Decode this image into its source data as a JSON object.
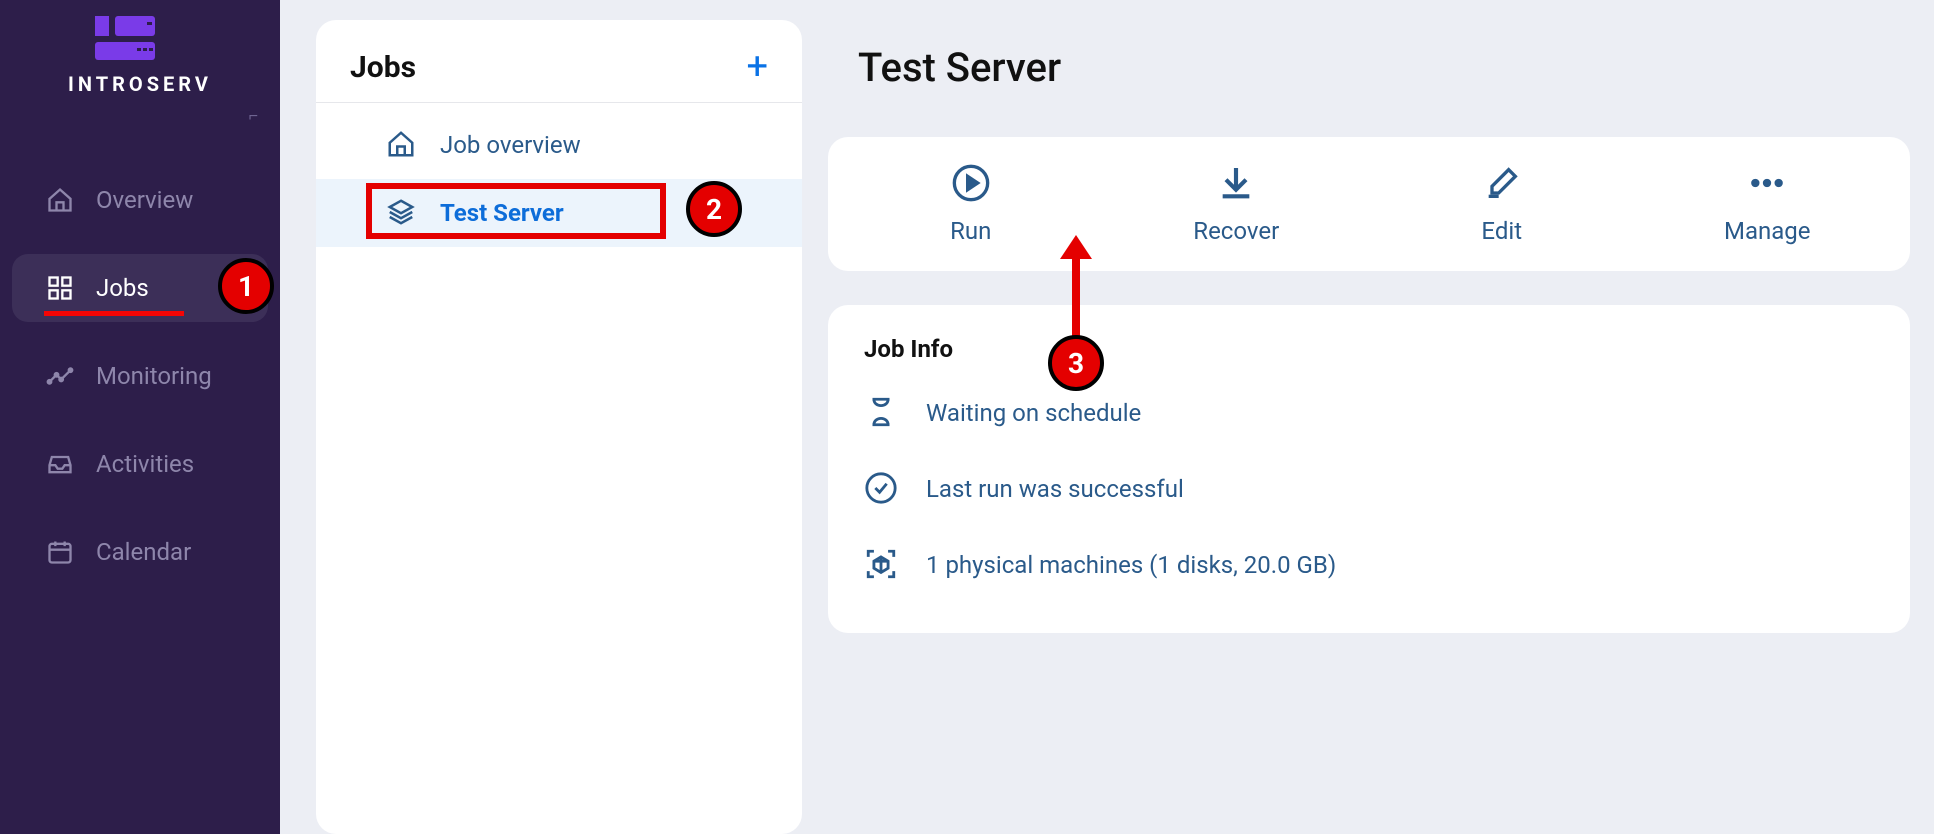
{
  "brand": {
    "name": "INTROSERV"
  },
  "sidebar": {
    "items": [
      {
        "label": "Overview",
        "icon": "home"
      },
      {
        "label": "Jobs",
        "icon": "grid"
      },
      {
        "label": "Monitoring",
        "icon": "chart"
      },
      {
        "label": "Activities",
        "icon": "inbox"
      },
      {
        "label": "Calendar",
        "icon": "calendar"
      }
    ],
    "active_index": 1
  },
  "jobs_panel": {
    "title": "Jobs",
    "items": [
      {
        "label": "Job overview",
        "icon": "home"
      },
      {
        "label": "Test Server",
        "icon": "stack"
      }
    ],
    "selected_index": 1
  },
  "page": {
    "title": "Test Server"
  },
  "actions": [
    {
      "label": "Run",
      "icon": "play"
    },
    {
      "label": "Recover",
      "icon": "download"
    },
    {
      "label": "Edit",
      "icon": "edit"
    },
    {
      "label": "Manage",
      "icon": "more"
    }
  ],
  "job_info": {
    "title": "Job Info",
    "rows": [
      {
        "icon": "hourglass",
        "text": "Waiting on schedule"
      },
      {
        "icon": "check",
        "text": "Last run was successful"
      },
      {
        "icon": "cube",
        "text": "1 physical machines (1 disks, 20.0 GB)"
      }
    ]
  },
  "annotations": {
    "badge1": "1",
    "badge2": "2",
    "badge3": "3"
  }
}
